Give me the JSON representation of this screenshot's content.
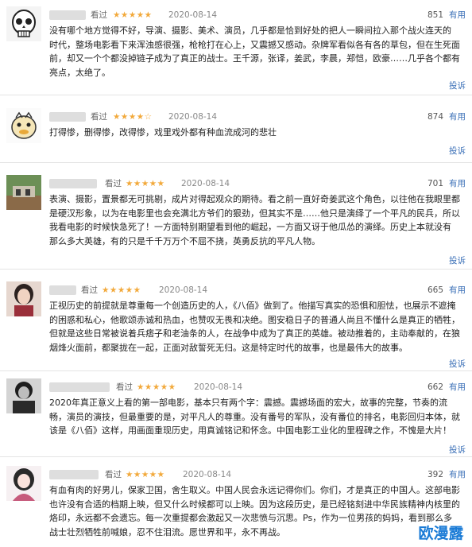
{
  "reviews": [
    {
      "status": "看过",
      "stars": "★★★★★",
      "date": "2020-08-14",
      "votes": "851",
      "useful": "有用",
      "content": "没有哪个地方觉得不好，导演、摄影、美术、演员，几乎都是恰到好处的把人一瞬间拉入那个战火连天的\n时代，整场电影看下来浑浊感很强，枪枪打在心上，又震撼又感动。杂牌军看似各有各的草包，但在生死面\n前，却又一个个都没掉链子成为了真正的战士。王千源，张译，姜武，李晨，郑恺，欧豪……几乎各个都有\n亮点，太绝了。",
      "report": "投诉"
    },
    {
      "status": "看过",
      "stars": "★★★★☆",
      "date": "2020-08-14",
      "votes": "874",
      "useful": "有用",
      "content": "打得惨，删得惨，改得惨，戏里戏外都有种血流成河的悲壮",
      "report": "投诉"
    },
    {
      "status": "看过",
      "stars": "★★★★★",
      "date": "2020-08-14",
      "votes": "701",
      "useful": "有用",
      "content": "表演、摄影，置景都无可挑剔，成片对得起观众的期待。看之前一直好奇姜武这个角色，以往他在我眼里都\n是硬汉形象，以为在电影里也会充满北方爷们的狠劲，但其实不是……他只是演绎了一个平凡的民兵，所以\n我看电影的时候快急死了！一方面特别期望看到他的崛起，一方面又讶于他瓜怂的演绎。历史上本就没有\n那么多大英雄，有的只是千千万万个不屈不挠，英勇反抗的平凡人物。",
      "report": "投诉"
    },
    {
      "status": "看过",
      "stars": "★★★★★",
      "date": "2020-08-14",
      "votes": "665",
      "useful": "有用",
      "content": "正视历史的前提就是尊重每一个创造历史的人，《八佰》做到了。他描写真实的恐惧和胆怯，也展示不遮掩\n的困惑和私心，他歌颂赤诚和热血，也赞叹无畏和决绝。图安稳日子的普通人尚且不懂什么是真正的牺牲，\n但就是这些日常被说着兵痞子和老油条的人，在战争中成为了真正的英雄。被动推着的，主动奉献的，在狼\n烟烽火面前，都聚拢在一起，正面对敌誓死无归。这是特定时代的故事，也是最伟大的故事。",
      "report": "投诉"
    },
    {
      "status": "看过",
      "stars": "★★★★★",
      "date": "2020-08-14",
      "votes": "662",
      "useful": "有用",
      "content": "2020年真正意义上看的第一部电影，基本只有两个字：震撼。震撼场面的宏大，故事的完整，节奏的流\n畅，演员的演技，但最重要的是，对平凡人的尊重。没有番号的军队，没有番位的排名，电影回归本体，就\n该是《八佰》这样，用画面重现历史，用真诚铭记和怀念。中国电影工业化的里程碑之作，不愧是大片！",
      "report": "投诉"
    },
    {
      "status": "看过",
      "stars": "★★★★★",
      "date": "2020-08-14",
      "votes": "392",
      "useful": "有用",
      "content": "有血有肉的好男儿，保家卫国，舍生取义。中国人民会永远记得你们。你们，才是真正的中国人。这部电影\n也许没有合适的档期上映，但又什么时候都可以上映。因为这段历史，是已经铭刻进中华民族精神内核里的\n烙印，永远都不会遗忘。每一次重提都会激起又一次悲愤与沉思。Ps，作为一位男孩的妈妈，看到那么多\n战士壮烈牺牲前喊娘，忍不住泪流。愿世界和平，永不再战。",
      "report": "投诉"
    }
  ],
  "watermark": "欧漫露"
}
